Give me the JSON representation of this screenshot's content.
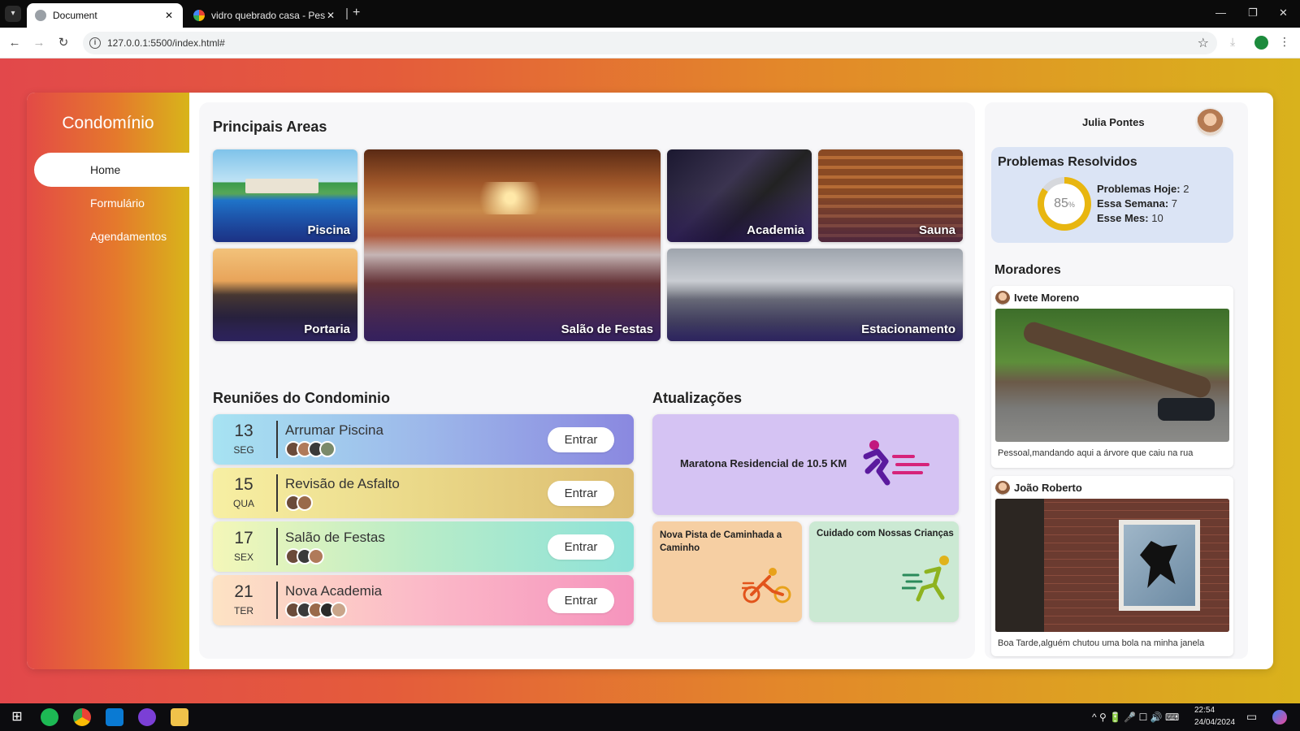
{
  "browser": {
    "tabs": [
      {
        "label": "Document",
        "active": true
      },
      {
        "label": "vidro quebrado casa - Pesquisa",
        "active": false
      }
    ],
    "url": "127.0.0.1:5500/index.html#"
  },
  "sidebar": {
    "brand": "Condomínio",
    "items": [
      {
        "label": "Home",
        "active": true
      },
      {
        "label": "Formulário"
      },
      {
        "label": "Agendamentos"
      }
    ]
  },
  "areas": {
    "title": "Principais Areas",
    "items": [
      {
        "label": "Piscina"
      },
      {
        "label": "Salão de Festas"
      },
      {
        "label": "Academia"
      },
      {
        "label": "Sauna"
      },
      {
        "label": "Portaria"
      },
      {
        "label": "Estacionamento"
      }
    ]
  },
  "meetings": {
    "title": "Reuniões do Condominio",
    "button_label": "Entrar",
    "items": [
      {
        "day": "13",
        "weekday": "SEG",
        "title": "Arrumar Piscina",
        "attendees": 4
      },
      {
        "day": "15",
        "weekday": "QUA",
        "title": "Revisão de Asfalto",
        "attendees": 2
      },
      {
        "day": "17",
        "weekday": "SEX",
        "title": "Salão de Festas",
        "attendees": 3
      },
      {
        "day": "21",
        "weekday": "TER",
        "title": "Nova Academia",
        "attendees": 5
      }
    ]
  },
  "updates": {
    "title": "Atualizações",
    "items": [
      {
        "text": "Maratona Residencial de 10.5 KM",
        "icon": "running-icon"
      },
      {
        "text": "Nova Pista de Caminhada a Caminho",
        "icon": "cyclist-icon"
      },
      {
        "text": "Cuidado com Nossas Crianças",
        "icon": "kids-running-icon"
      }
    ]
  },
  "user": {
    "name": "Julia Pontes"
  },
  "stats": {
    "title": "Problemas Resolvidos",
    "percent": "85",
    "percent_sign": "%",
    "progress": 85,
    "today_label": "Problemas Hoje:",
    "today_value": "2",
    "week_label": "Essa Semana:",
    "week_value": "7",
    "month_label": "Esse Mes:",
    "month_value": "10"
  },
  "residents": {
    "title": "Moradores",
    "posts": [
      {
        "name": "Ivete Moreno",
        "text": "Pessoal,mandando aqui a árvore que caiu na rua"
      },
      {
        "name": "João Roberto",
        "text": "Boa Tarde,alguém chutou uma bola na minha janela"
      }
    ]
  },
  "taskbar": {
    "time": "22:54",
    "date": "24/04/2024"
  },
  "colors": {
    "page_gradient_start": "#e2484b",
    "page_gradient_end": "#d9b21c",
    "donut_fill": "#e8b610",
    "stats_bg": "#dbe4f5"
  }
}
